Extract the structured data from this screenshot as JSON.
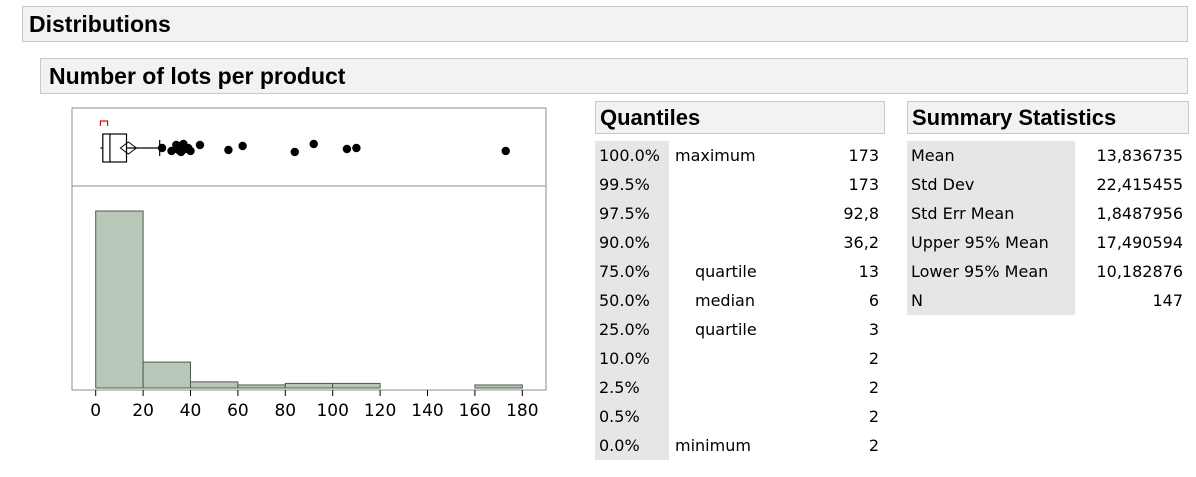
{
  "headers": {
    "distributions": "Distributions",
    "variable": "Number of lots per product",
    "quantiles": "Quantiles",
    "summary": "Summary Statistics"
  },
  "quantiles": [
    {
      "pct": "100.0%",
      "desc": "maximum",
      "value": "173"
    },
    {
      "pct": "99.5%",
      "desc": "",
      "value": "173"
    },
    {
      "pct": "97.5%",
      "desc": "",
      "value": "92,8"
    },
    {
      "pct": "90.0%",
      "desc": "",
      "value": "36,2"
    },
    {
      "pct": "75.0%",
      "desc": "quartile",
      "value": "13"
    },
    {
      "pct": "50.0%",
      "desc": "median",
      "value": "6"
    },
    {
      "pct": "25.0%",
      "desc": "quartile",
      "value": "3"
    },
    {
      "pct": "10.0%",
      "desc": "",
      "value": "2"
    },
    {
      "pct": "2.5%",
      "desc": "",
      "value": "2"
    },
    {
      "pct": "0.5%",
      "desc": "",
      "value": "2"
    },
    {
      "pct": "0.0%",
      "desc": "minimum",
      "value": "2"
    }
  ],
  "summary": [
    {
      "label": "Mean",
      "value": "13,836735"
    },
    {
      "label": "Std Dev",
      "value": "22,415455"
    },
    {
      "label": "Std Err Mean",
      "value": "1,8487956"
    },
    {
      "label": "Upper 95% Mean",
      "value": "17,490594"
    },
    {
      "label": "Lower 95% Mean",
      "value": "10,182876"
    },
    {
      "label": "N",
      "value": "147"
    }
  ],
  "chart_data": {
    "type": "histogram",
    "bins": [
      {
        "from": 0,
        "to": 20,
        "count": 116
      },
      {
        "from": 20,
        "to": 40,
        "count": 17
      },
      {
        "from": 40,
        "to": 60,
        "count": 4
      },
      {
        "from": 60,
        "to": 80,
        "count": 2
      },
      {
        "from": 80,
        "to": 100,
        "count": 3
      },
      {
        "from": 100,
        "to": 120,
        "count": 3
      },
      {
        "from": 120,
        "to": 140,
        "count": 0
      },
      {
        "from": 140,
        "to": 160,
        "count": 0
      },
      {
        "from": 160,
        "to": 180,
        "count": 2
      }
    ],
    "xticks": [
      0,
      20,
      40,
      60,
      80,
      100,
      120,
      140,
      160,
      180
    ],
    "xlim": [
      -10,
      190
    ],
    "boxplot": {
      "min": 2,
      "q1": 3,
      "median": 6,
      "q3": 13,
      "whisker_high": 27,
      "mean": 13.8,
      "shortest_half": [
        2,
        5
      ]
    },
    "outliers": [
      28,
      32,
      34,
      35,
      36,
      36,
      37,
      38,
      39,
      40,
      44,
      56,
      62,
      84,
      92,
      106,
      110,
      173
    ],
    "colors": {
      "bar_fill": "#b9c7b9",
      "bar_stroke": "#4d5a4d",
      "shortest_half": "#d01010"
    }
  }
}
